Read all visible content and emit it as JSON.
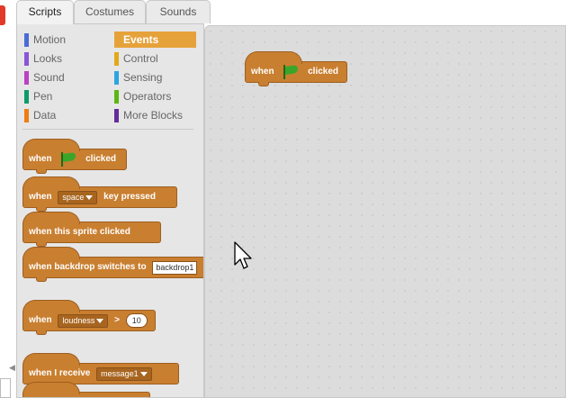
{
  "tabs": [
    {
      "label": "Scripts",
      "active": true
    },
    {
      "label": "Costumes",
      "active": false
    },
    {
      "label": "Sounds",
      "active": false
    }
  ],
  "categories": [
    {
      "label": "Motion",
      "color": "#4a6cd4"
    },
    {
      "label": "Events",
      "color": "#c88330",
      "active": true
    },
    {
      "label": "Looks",
      "color": "#8a55d7"
    },
    {
      "label": "Control",
      "color": "#e1a91a"
    },
    {
      "label": "Sound",
      "color": "#bb42c3"
    },
    {
      "label": "Sensing",
      "color": "#2ca5e2"
    },
    {
      "label": "Pen",
      "color": "#0e9a6c"
    },
    {
      "label": "Operators",
      "color": "#5cb712"
    },
    {
      "label": "Data",
      "color": "#ee7d16"
    },
    {
      "label": "More Blocks",
      "color": "#632d99"
    }
  ],
  "palette_blocks": {
    "flag_clicked": {
      "before": "when",
      "after": "clicked",
      "icon": "green-flag-icon"
    },
    "key_pressed": {
      "before": "when",
      "dropdown": "space",
      "after": "key pressed"
    },
    "sprite_clicked": {
      "text": "when this sprite clicked"
    },
    "backdrop_switches": {
      "text": "when backdrop switches to",
      "dropdown": "backdrop1"
    },
    "loudness": {
      "before": "when",
      "dropdown": "loudness",
      "op": ">",
      "value": "10"
    },
    "receive": {
      "text": "when I receive",
      "dropdown": "message1"
    }
  },
  "script_blocks": {
    "flag_clicked": {
      "before": "when",
      "after": "clicked",
      "icon": "green-flag-icon"
    }
  },
  "colors": {
    "events_block": "#c97f30",
    "script_area_bg": "#dcdcdc",
    "palette_bg": "#e6e6e6"
  }
}
